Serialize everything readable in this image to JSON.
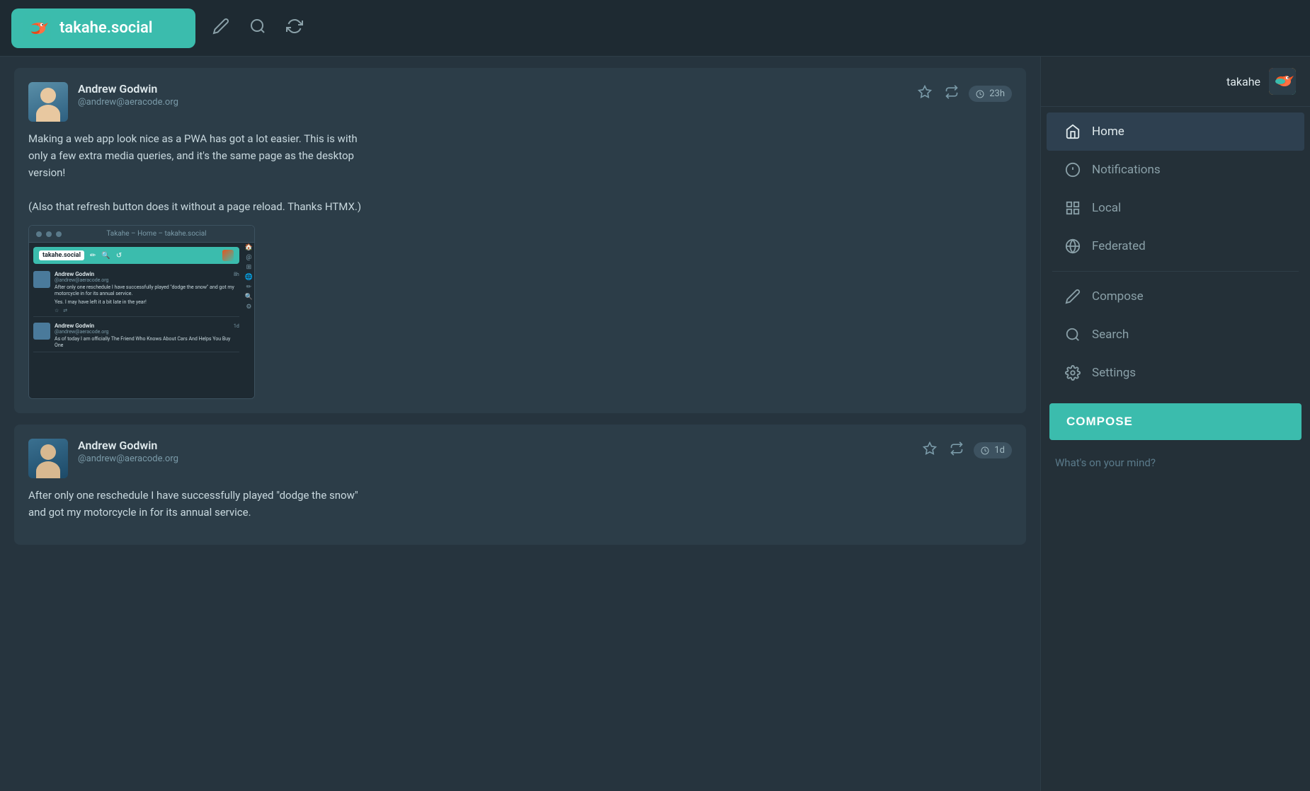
{
  "app": {
    "name": "takahe.social",
    "title": "takahe.social"
  },
  "header": {
    "logo_text": "takahe.social",
    "user_display": "takahe"
  },
  "nav": {
    "items": [
      {
        "id": "home",
        "label": "Home",
        "icon": "home",
        "active": true
      },
      {
        "id": "notifications",
        "label": "Notifications",
        "icon": "at"
      },
      {
        "id": "local",
        "label": "Local",
        "icon": "grid"
      },
      {
        "id": "federated",
        "label": "Federated",
        "icon": "globe"
      },
      {
        "id": "compose",
        "label": "Compose",
        "icon": "pen"
      },
      {
        "id": "search",
        "label": "Search",
        "icon": "search"
      },
      {
        "id": "settings",
        "label": "Settings",
        "icon": "gear"
      }
    ]
  },
  "compose": {
    "button_label": "COMPOSE",
    "placeholder": "What's on your mind?"
  },
  "posts": [
    {
      "id": "post1",
      "author_name": "Andrew Godwin",
      "author_handle": "@andrew@aeracode.org",
      "time_ago": "23h",
      "content_line1": "Making a web app look nice as a PWA has got a lot easier. This is with",
      "content_line2": "only a few extra media queries, and it's the same page as the desktop",
      "content_line3": "version!",
      "content_line4": "",
      "content_line5": "(Also that refresh button does it without a page reload. Thanks HTMX.)",
      "has_image": true,
      "image_url_text": "Takahe – Home – takahe.social"
    },
    {
      "id": "post2",
      "author_name": "Andrew Godwin",
      "author_handle": "@andrew@aeracode.org",
      "time_ago": "1d",
      "content_line1": "After only one reschedule I have successfully played \"dodge the snow\"",
      "content_line2": "and got my motorcycle in for its annual service."
    }
  ],
  "preview": {
    "title_bar_text": "Takahe – Home – takahe.social",
    "logo_text": "takahe.social",
    "post1_name": "Andrew Godwin",
    "post1_handle": "@andrew@aeracode.org",
    "post1_time": "8h",
    "post1_text": "After only one reschedule I have successfully played \"dodge the snow\" and got my motorcycle in for its annual service.",
    "post1_footer": "Yes. I may have left it a bit late in the year!",
    "post2_name": "Andrew Godwin",
    "post2_handle": "@andrew@aeracode.org",
    "post2_time": "1d",
    "post2_text": "As of today I am officially The Friend Who Knows About Cars And Helps You Buy One"
  }
}
